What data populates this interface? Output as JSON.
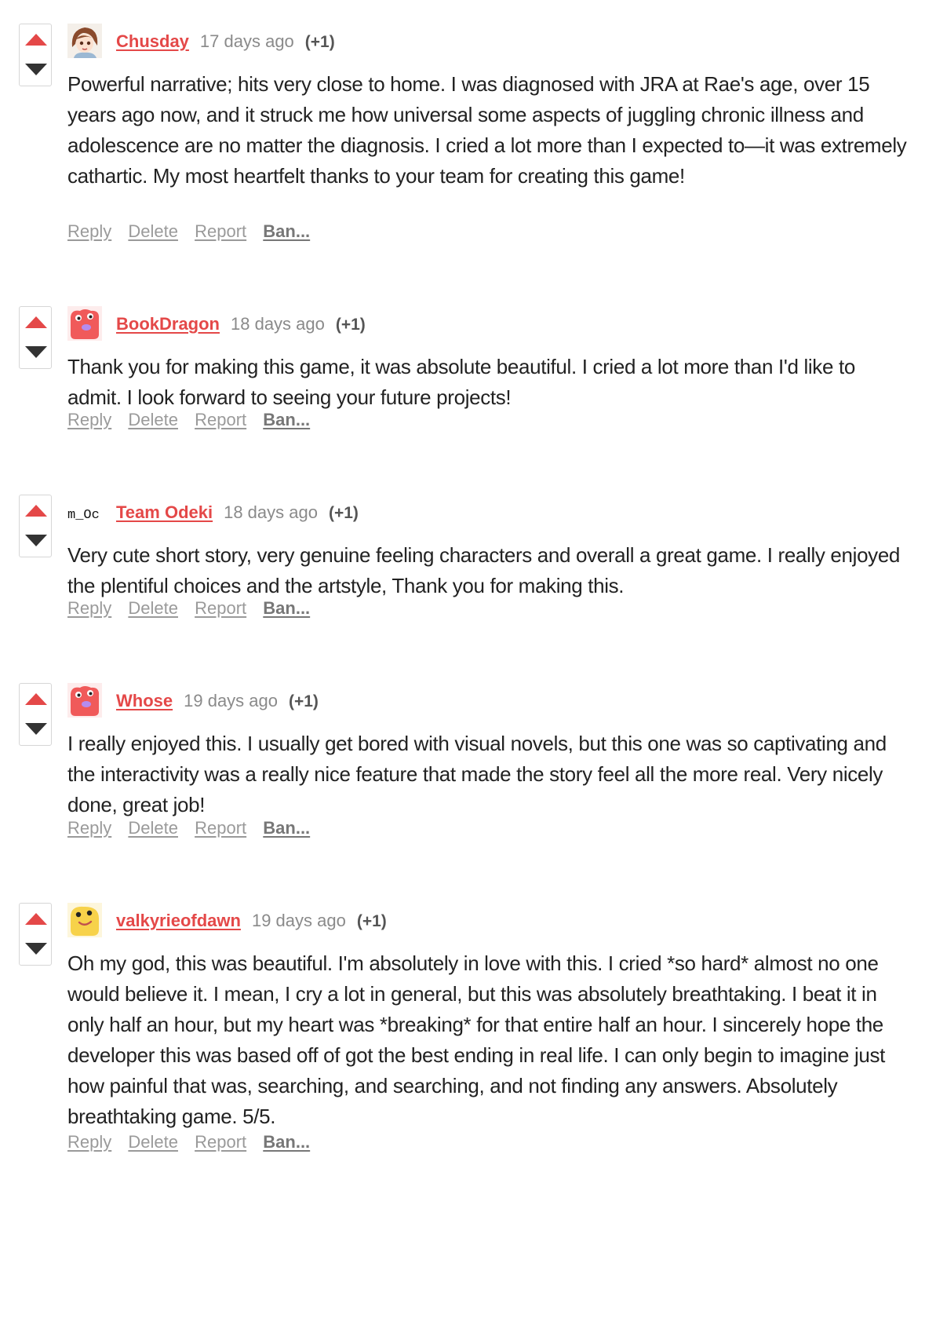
{
  "comments": [
    {
      "avatar": "anime-girl-avatar",
      "username": "Chusday",
      "date": "17 days ago",
      "score": "(+1)",
      "text": "Powerful narrative; hits very close to home. I was diagnosed with JRA at Rae's age, over 15 years ago now, and it struck me how universal some aspects of juggling chronic illness and adolescence are no matter the diagnosis. I cried a lot more than I expected to—it was extremely cathartic. My most heartfelt thanks to your team for creating this game!",
      "actions": {
        "reply": "Reply",
        "delete": "Delete",
        "report": "Report",
        "ban": "Ban..."
      }
    },
    {
      "avatar": "red-blob-avatar",
      "username": "BookDragon",
      "date": "18 days ago",
      "score": "(+1)",
      "text": "Thank you for making this game, it was absolute beautiful. I cried a lot more than I'd like to admit. I look forward to seeing your future projects!",
      "actions": {
        "reply": "Reply",
        "delete": "Delete",
        "report": "Report",
        "ban": "Ban..."
      }
    },
    {
      "avatar": "team-logo-avatar",
      "username": "Team Odeki",
      "date": "18 days ago",
      "score": "(+1)",
      "text": "Very cute short story, very genuine feeling characters and overall a great game.  I really enjoyed the plentiful choices and the artstyle, Thank you for making this.",
      "actions": {
        "reply": "Reply",
        "delete": "Delete",
        "report": "Report",
        "ban": "Ban..."
      }
    },
    {
      "avatar": "red-blob-avatar",
      "username": "Whose",
      "date": "19 days ago",
      "score": "(+1)",
      "text": "I really enjoyed this. I usually get bored with visual novels, but this one was so captivating and the interactivity was a really nice feature that made the story feel all the more real. Very nicely done, great job!",
      "actions": {
        "reply": "Reply",
        "delete": "Delete",
        "report": "Report",
        "ban": "Ban..."
      }
    },
    {
      "avatar": "yellow-blob-avatar",
      "username": "valkyrieofdawn",
      "date": "19 days ago",
      "score": "(+1)",
      "text": "Oh my god, this was beautiful. I'm absolutely in love with this. I cried *so hard* almost no one would believe it. I mean, I cry a lot in general, but this was absolutely breathtaking. I beat it in only half an hour, but my heart was *breaking* for that entire half an hour. I sincerely hope the developer this was based off of got the best ending in real life. I can only begin to imagine just how painful that was, searching, and searching, and not finding any answers. Absolutely breathtaking game. 5/5.",
      "actions": {
        "reply": "Reply",
        "delete": "Delete",
        "report": "Report",
        "ban": "Ban..."
      }
    }
  ],
  "colors": {
    "accent": "#e44848",
    "downvote": "#333333",
    "meta": "#8a8a8a",
    "text": "#222222",
    "blob_red": "#f05a5a",
    "blob_yellow": "#f7d24a"
  },
  "avatar_text": "m_Oc"
}
